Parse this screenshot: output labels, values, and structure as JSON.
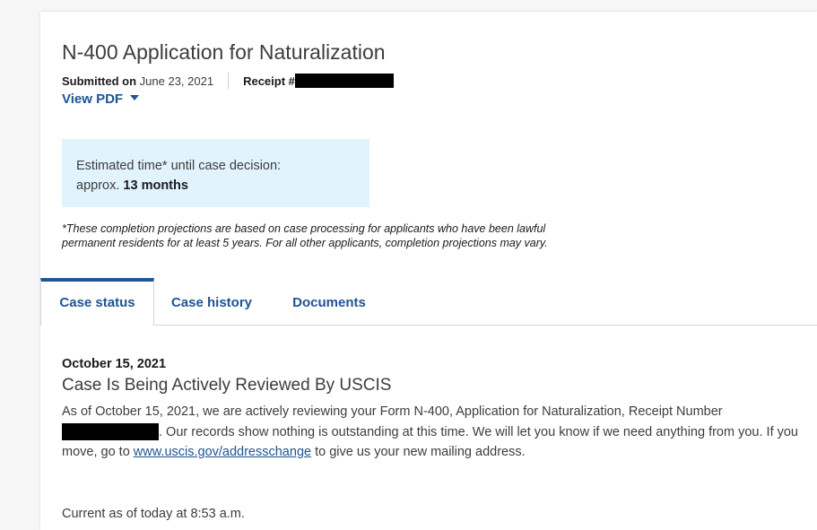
{
  "application": {
    "title": "N-400 Application for Naturalization",
    "submitted_label": "Submitted on",
    "submitted_date": "June 23, 2021",
    "receipt_label": "Receipt #",
    "view_pdf": "View PDF"
  },
  "estimate": {
    "line1": "Estimated time* until case decision:",
    "prefix": "approx.",
    "value": "13 months"
  },
  "footnote": "*These completion projections are based on case processing for applicants who have been lawful permanent residents for at least 5 years. For all other applicants, completion projections may vary.",
  "tabs": [
    {
      "label": "Case status"
    },
    {
      "label": "Case history"
    },
    {
      "label": "Documents"
    }
  ],
  "status": {
    "date": "October 15, 2021",
    "title": "Case Is Being Actively Reviewed By USCIS",
    "body_part1": "As of October 15, 2021, we are actively reviewing your Form N-400, Application for Naturalization, Receipt Number",
    "body_part2": ". Our records show nothing is outstanding at this time. We will let you know if we need anything from you. If you move, go to",
    "link": "www.uscis.gov/addresschange",
    "body_part3": "to give us your new mailing address.",
    "current": "Current as of today at 8:53 a.m."
  },
  "colors": {
    "link": "#205493",
    "estimate_bg": "#e1f3fd",
    "redaction": "#000000"
  },
  "icons": {
    "view_pdf": "caret-down-icon"
  }
}
